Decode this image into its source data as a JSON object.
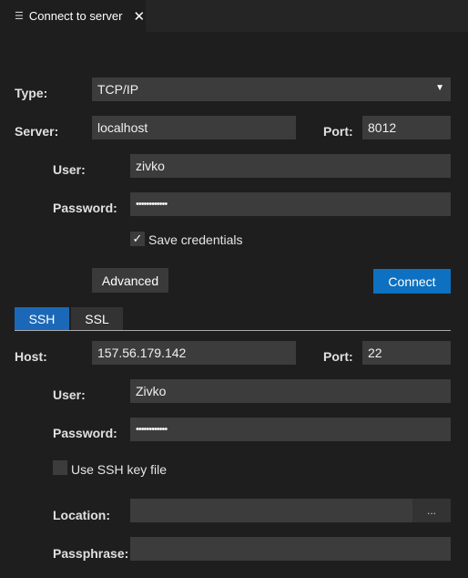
{
  "tab": {
    "title": "Connect to server",
    "icon": "list-icon",
    "close_icon": "close-icon"
  },
  "form": {
    "type_label": "Type:",
    "type_value": "TCP/IP",
    "server_label": "Server:",
    "server_value": "localhost",
    "port_label": "Port:",
    "port_value": "8012",
    "user_label": "User:",
    "user_value": "zivko",
    "password_label": "Password:",
    "password_value": "••••••••••••",
    "save_credentials_label": "Save credentials",
    "save_credentials_checked": true,
    "advanced_label": "Advanced",
    "connect_label": "Connect"
  },
  "subtabs": [
    "SSH",
    "SSL"
  ],
  "ssh": {
    "host_label": "Host:",
    "host_value": "157.56.179.142",
    "port_label": "Port:",
    "port_value": "22",
    "user_label": "User:",
    "user_value": "Zivko",
    "password_label": "Password:",
    "password_value": "••••••••••••",
    "use_key_label": "Use SSH key file",
    "use_key_checked": false,
    "location_label": "Location:",
    "location_value": "",
    "browse_label": "...",
    "passphrase_label": "Passphrase:",
    "passphrase_value": ""
  },
  "colors": {
    "accent": "#0e70c0",
    "active_subtab": "#1c68b8",
    "background": "#1e1e1e",
    "field": "#3c3c3c"
  }
}
